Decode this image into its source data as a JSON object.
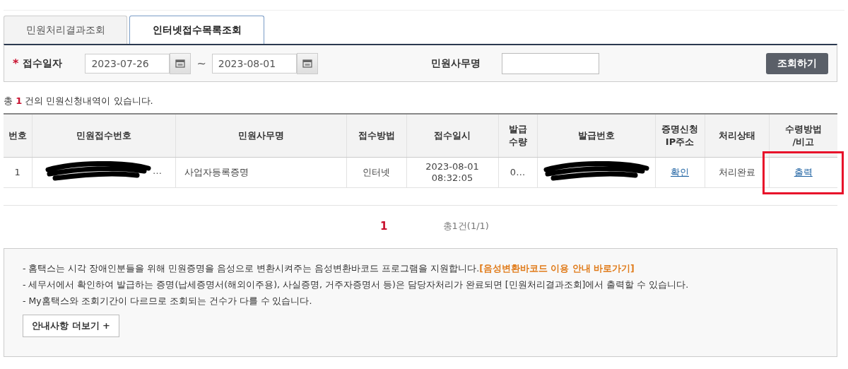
{
  "tabs": [
    {
      "label": "민원처리결과조회",
      "selected": false
    },
    {
      "label": "인터넷접수목록조회",
      "selected": true
    }
  ],
  "search": {
    "required_mark": "*",
    "date_label": "접수일자",
    "date_from": "2023-07-26",
    "separator": "~",
    "date_to": "2023-08-01",
    "name_label": "민원사무명",
    "button": "조회하기"
  },
  "summary": {
    "prefix": "총",
    "count": "1",
    "suffix": "건의 민원신청내역이 있습니다."
  },
  "table": {
    "columns": [
      "번호",
      "민원접수번호",
      "민원사무명",
      "접수방법",
      "접수일시",
      "발급\n수량",
      "발급번호",
      "증명신청\nIP주소",
      "처리상태",
      "수령방법\n/비고"
    ],
    "rows": [
      {
        "cells": [
          {
            "kind": "text",
            "text": "1",
            "highlighted": false
          },
          {
            "kind": "redacted",
            "text": "…",
            "highlighted": false
          },
          {
            "kind": "text",
            "text": "사업자등록증명",
            "highlighted": false
          },
          {
            "kind": "text",
            "text": "인터넷",
            "highlighted": false
          },
          {
            "kind": "text",
            "text": "2023-08-01\n08:32:05",
            "highlighted": false
          },
          {
            "kind": "text",
            "text": "0…",
            "highlighted": false
          },
          {
            "kind": "redacted",
            "text": "",
            "highlighted": false
          },
          {
            "kind": "link",
            "text": "확인",
            "highlighted": false
          },
          {
            "kind": "text",
            "text": "처리완료",
            "highlighted": false
          },
          {
            "kind": "link",
            "text": "출력",
            "highlighted": true
          }
        ]
      }
    ]
  },
  "pagination": {
    "pages": [
      {
        "label": "1",
        "selected": true
      }
    ],
    "total": "총1건(1/1)"
  },
  "notice": {
    "lines": [
      {
        "text": "- 홈택스는 시각 장애인분들을 위해 민원증명을 음성으로 변환시켜주는 음성변환바코드 프로그램을 지원합니다.",
        "link": "[음성변환바코드 이용 안내 바로가기]"
      },
      {
        "text": "- 세무서에서 확인하여 발급하는 증명(납세증명서(해외이주용), 사실증명, 거주자증명서 등)은 담당자처리가 완료되면 [민원처리결과조회]에서 출력할 수 있습니다."
      },
      {
        "text": "- My홈택스와 조회기간이 다르므로 조회되는 건수가 다를 수 있습니다."
      }
    ],
    "more_button": "안내사항 더보기 +"
  }
}
